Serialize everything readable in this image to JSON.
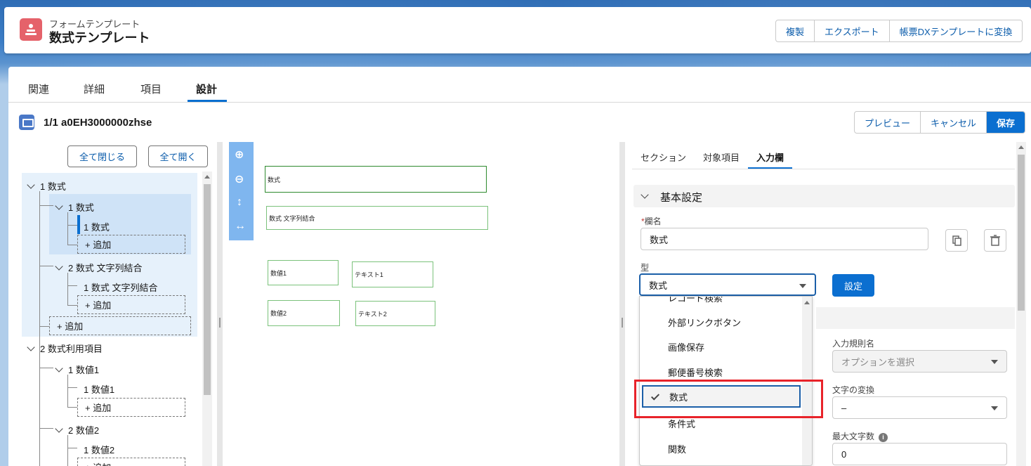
{
  "header": {
    "object_label": "フォームテンプレート",
    "record_title": "数式テンプレート",
    "actions": [
      "複製",
      "エクスポート",
      "帳票DXテンプレートに変換"
    ]
  },
  "tabs": [
    "関連",
    "詳細",
    "項目",
    "設計"
  ],
  "active_tab": "設計",
  "record_bar": {
    "title": "1/1 a0EH3000000zhse",
    "actions": [
      "プレビュー",
      "キャンセル",
      "保存"
    ]
  },
  "tree": {
    "collapse_all": "全て閉じる",
    "expand_all": "全て開く",
    "nodes": {
      "n1": "1 数式",
      "n1_1": "1 数式",
      "n1_1_1": "1 数式",
      "n1_2": "2 数式 文字列結合",
      "n1_2_1": "1 数式 文字列結合",
      "n2": "2 数式利用項目",
      "n2_1": "1 数値1",
      "n2_1_1": "1 数値1",
      "n2_2": "2 数値2",
      "n2_2_1": "1 数値2"
    },
    "add_label": "+ 追加"
  },
  "canvas": {
    "boxes": [
      "数式",
      "数式 文字列結合",
      "数値1",
      "テキスト1",
      "数値2",
      "テキスト2"
    ]
  },
  "right_panel": {
    "tabs": [
      "セクション",
      "対象項目",
      "入力欄"
    ],
    "active_tab": "入力欄",
    "section_title": "基本設定",
    "field_name_label": "欄名",
    "field_name_value": "数式",
    "type_label": "型",
    "type_value": "数式",
    "set_button": "設定",
    "validation_label": "入力規則名",
    "validation_placeholder": "オプションを選択",
    "conversion_label": "文字の変換",
    "conversion_value": "–",
    "max_length_label": "最大文字数",
    "max_length_value": "0"
  },
  "type_dropdown": {
    "options": [
      "レコード検索",
      "外部リンクボタン",
      "画像保存",
      "郵便番号検索",
      "数式",
      "条件式",
      "関数"
    ],
    "selected": "数式"
  }
}
